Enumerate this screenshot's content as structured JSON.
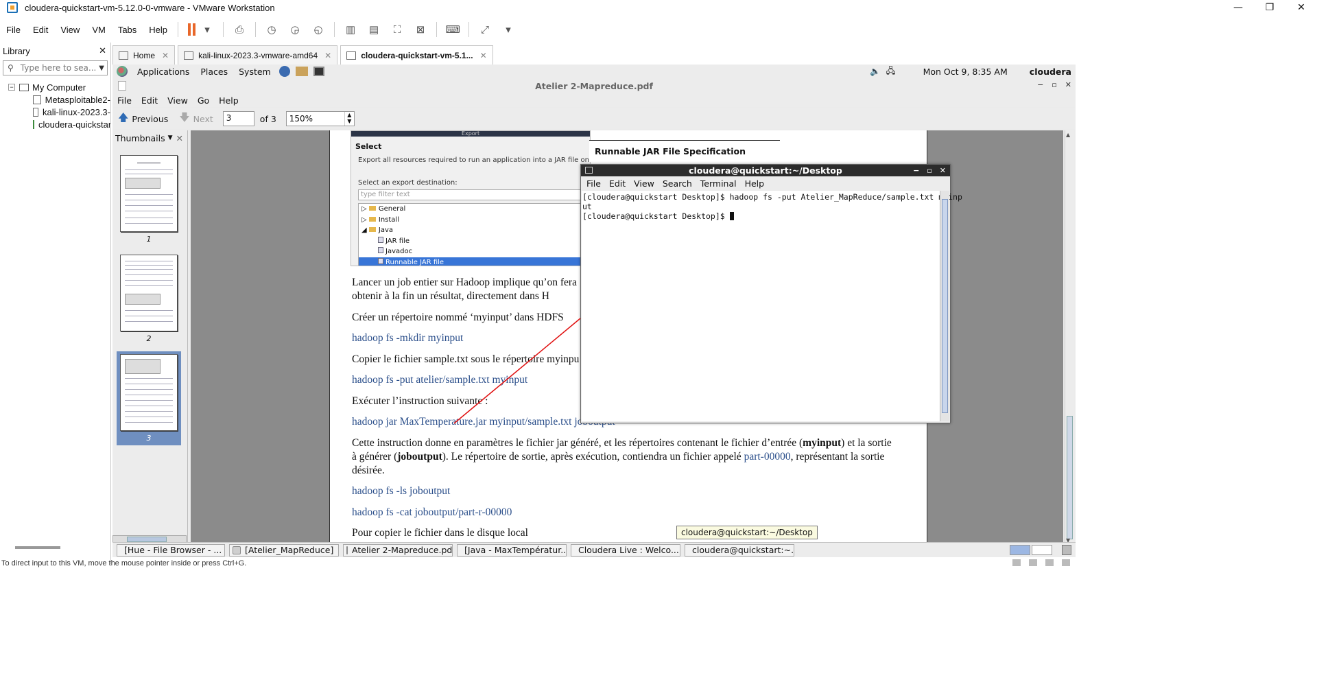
{
  "window": {
    "title": "cloudera-quickstart-vm-5.12.0-0-vmware - VMware Workstation"
  },
  "vm_menu": [
    "File",
    "Edit",
    "View",
    "VM",
    "Tabs",
    "Help"
  ],
  "library": {
    "title": "Library",
    "search_placeholder": "Type here to sea...",
    "tree": {
      "root": "My Computer",
      "items": [
        "Metasploitable2-",
        "kali-linux-2023.3-",
        "cloudera-quickstart"
      ]
    }
  },
  "vm_tabs": [
    {
      "label": "Home"
    },
    {
      "label": "kali-linux-2023.3-vmware-amd64"
    },
    {
      "label": "cloudera-quickstart-vm-5.1..."
    }
  ],
  "gnome_panel": {
    "menus": [
      "Applications",
      "Places",
      "System"
    ],
    "clock": "Mon Oct  9,  8:35 AM",
    "user": "cloudera"
  },
  "evince": {
    "title": "Atelier 2-Mapreduce.pdf",
    "menus": [
      "File",
      "Edit",
      "View",
      "Go",
      "Help"
    ],
    "previous": "Previous",
    "next": "Next",
    "page": "3",
    "of": "of 3",
    "zoom": "150%",
    "sidebar_label": "Thumbnails",
    "thumbnails": [
      "1",
      "2",
      "3"
    ],
    "selected_page": 3
  },
  "pdf": {
    "shot": {
      "header": "Export",
      "select": "Select",
      "desc": "Export all resources required to run an application into a JAR file on the local",
      "dest": "Select an export destination:",
      "filter": "type filter text",
      "tree": [
        "General",
        "Install",
        "Java",
        "JAR file",
        "Javadoc",
        "Runnable JAR file"
      ]
    },
    "spec_title": "Runnable JAR File Specification",
    "p1a": "Lancer un job entier sur Hadoop implique qu’on fera",
    "p1b": "obtenir  à  la  fin  un  résultat, directement dans H",
    "p2": "Créer un répertoire nommé ‘myinput’ dans HDFS",
    "cmd1": "hadoop fs -mkdir myinput",
    "p3": "Copier le fichier sample.txt sous le répertoire myinpu",
    "cmd2": "hadoop fs -put atelier/sample.txt myinput",
    "p4": "Exécuter l’instruction suivante :",
    "cmd3": "hadoop jar MaxTemperature.jar myinput/sample.txt joboutput",
    "p5_1": "Cette instruction donne en paramètres le fichier jar généré, et les répertoires contenant le fichier d’entrée (",
    "p5_b1": "myinput",
    "p5_2": ") et la sortie",
    "p5_3": "à générer (",
    "p5_b2": "joboutput",
    "p5_4": ").   Le répertoire de sortie, après exécution, contiendra un fichier appelé ",
    "p5_link": "part-00000",
    "p5_5": ", représentant la sortie",
    "p5_6": "désirée.",
    "cmd4": "hadoop fs -ls joboutput",
    "cmd5": "hadoop fs -cat joboutput/part-r-00000",
    "p6": "Pour copier le fichier dans le disque local"
  },
  "terminal": {
    "title": "cloudera@quickstart:~/Desktop",
    "menus": [
      "File",
      "Edit",
      "View",
      "Search",
      "Terminal",
      "Help"
    ],
    "line1": "[cloudera@quickstart Desktop]$ hadoop fs -put Atelier_MapReduce/sample.txt myinp",
    "line2": "ut",
    "line3": "[cloudera@quickstart Desktop]$ "
  },
  "tooltip": "cloudera@quickstart:~/Desktop",
  "taskbar": [
    {
      "label": "[Hue - File Browser - ...",
      "color": "#e8672a"
    },
    {
      "label": "[Atelier_MapReduce]",
      "color": "#cfcfcf"
    },
    {
      "label": "Atelier 2-Mapreduce.pdf",
      "color": "#ffffff"
    },
    {
      "label": "[Java - MaxTempératur...",
      "color": "#6b4a8c"
    },
    {
      "label": "Cloudera Live : Welco...",
      "color": "#e8672a"
    },
    {
      "label": "cloudera@quickstart:~...",
      "color": "#333333"
    }
  ],
  "status": "To direct input to this VM, move the mouse pointer inside or press Ctrl+G."
}
